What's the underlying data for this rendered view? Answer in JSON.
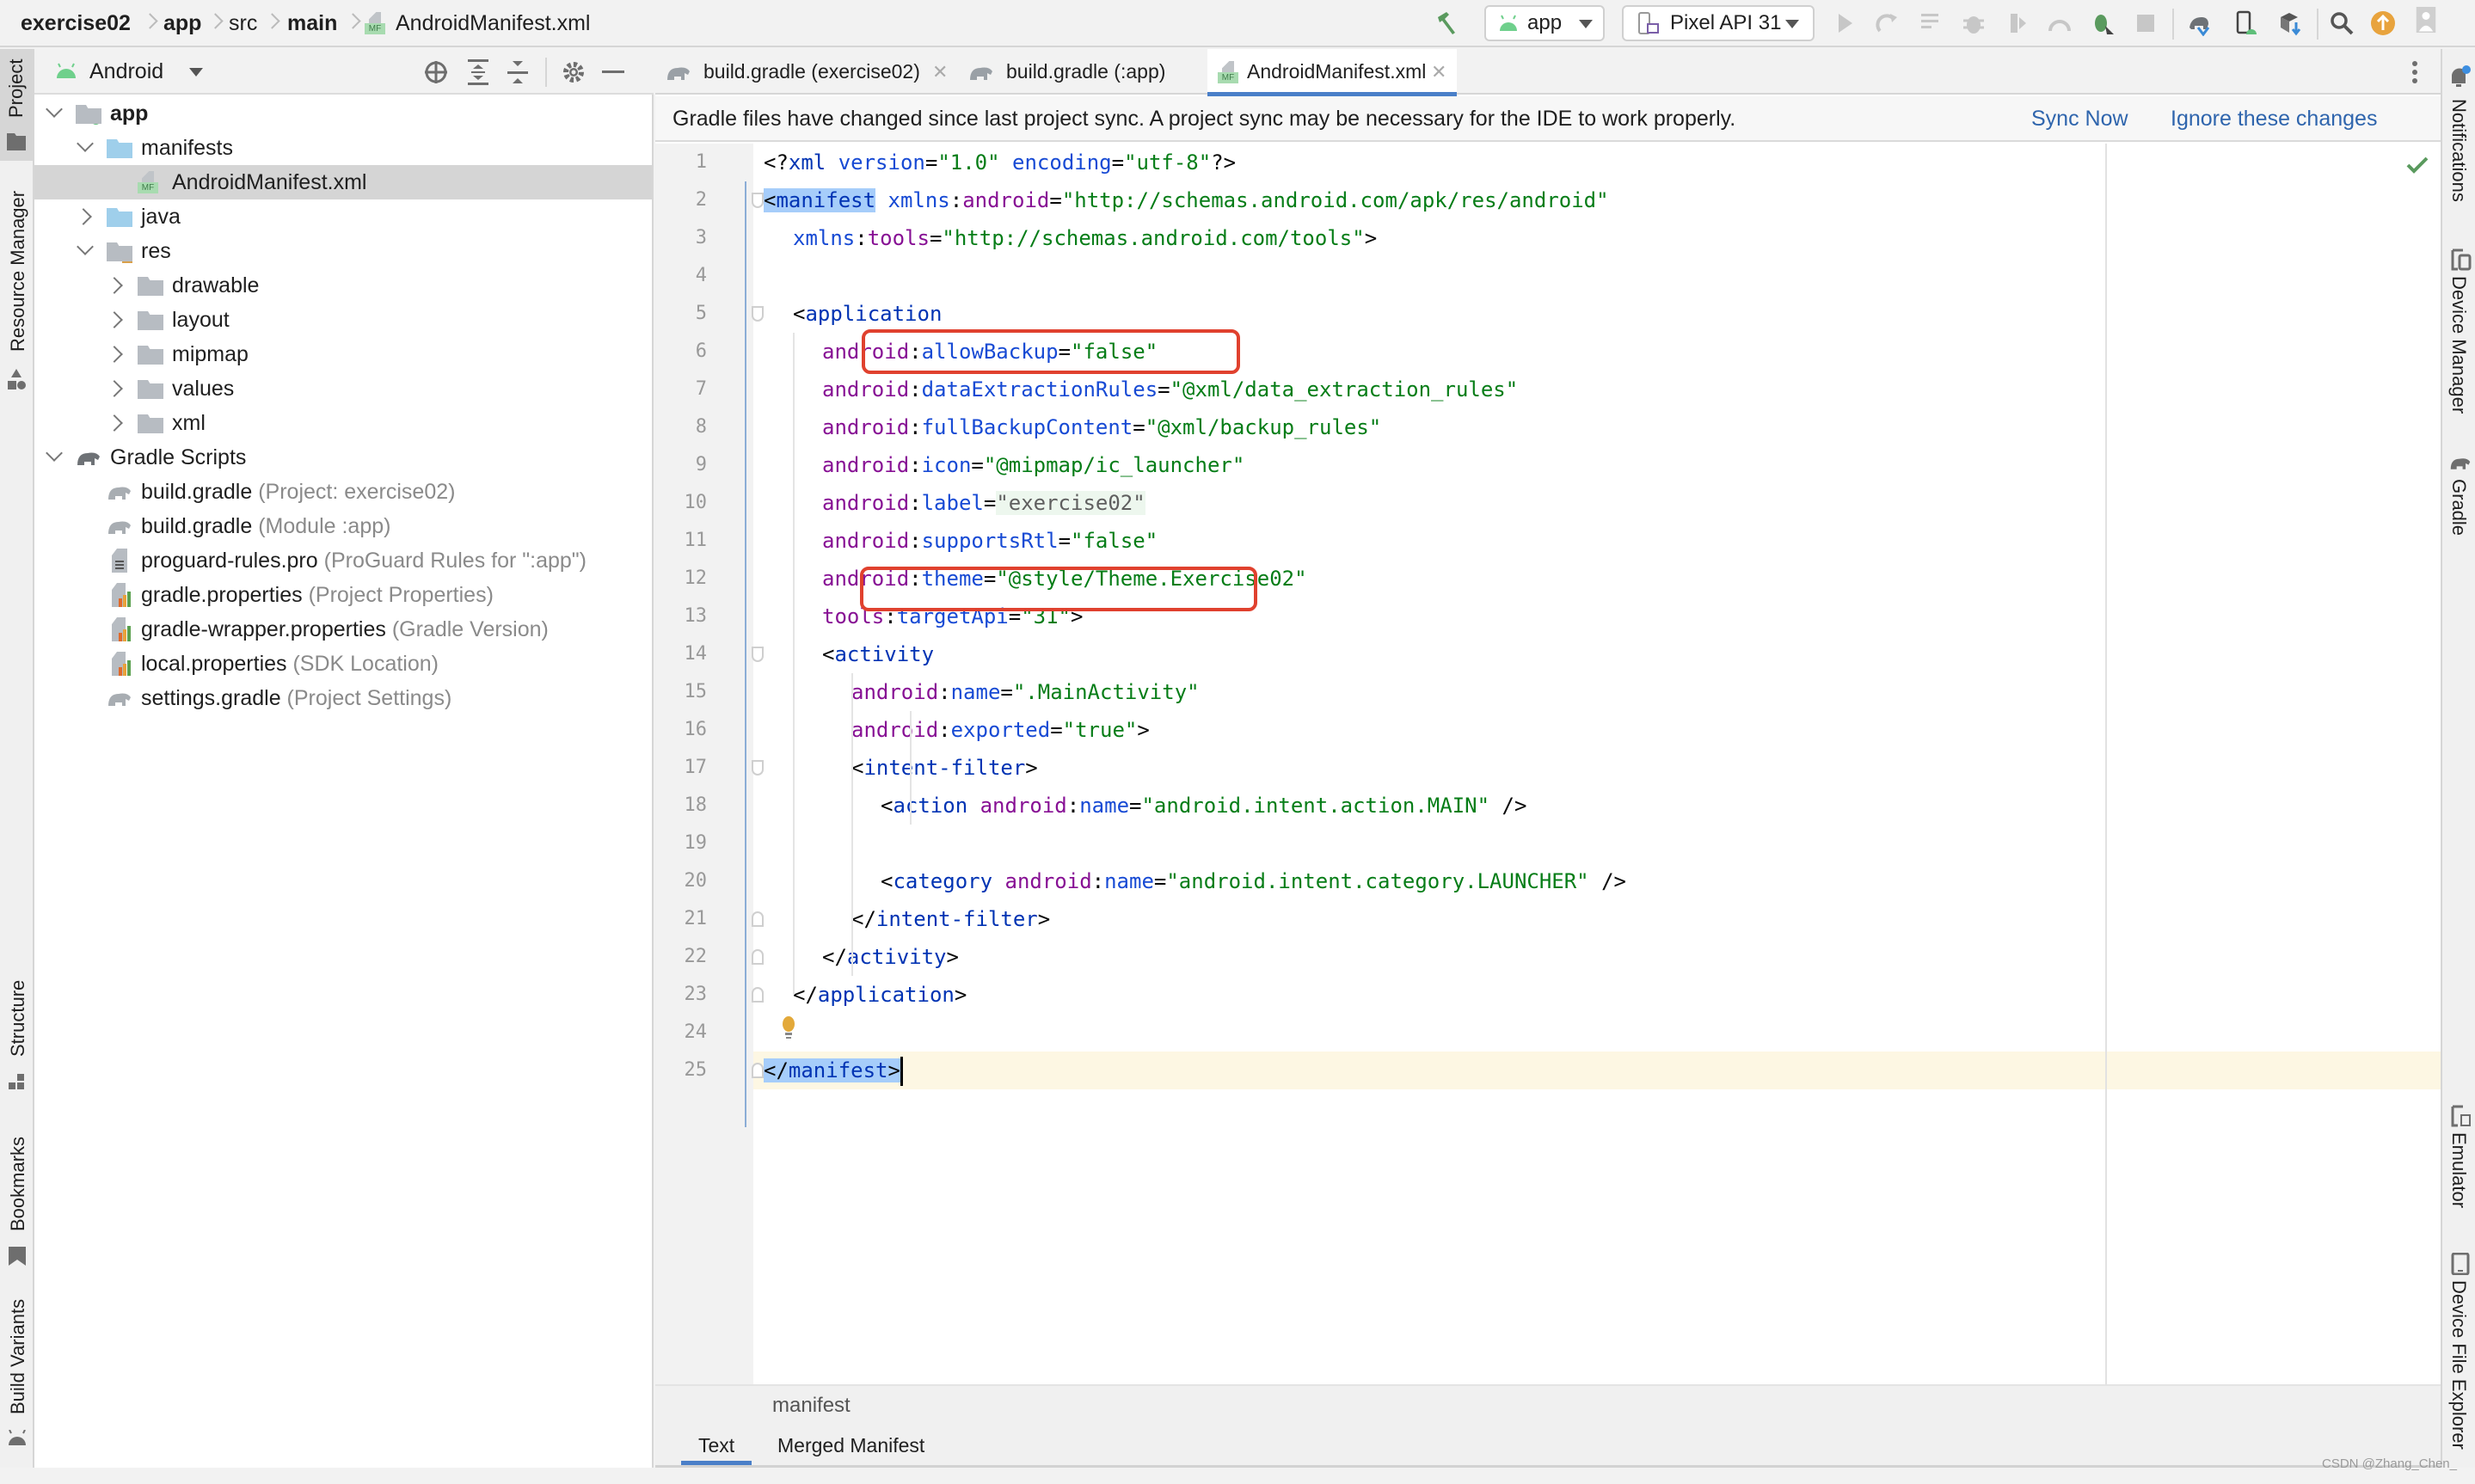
{
  "breadcrumb": [
    {
      "label": "exercise02",
      "bold": true
    },
    {
      "label": "app",
      "bold": true
    },
    {
      "label": "src",
      "bold": false
    },
    {
      "label": "main",
      "bold": true
    },
    {
      "label": "AndroidManifest.xml",
      "bold": false,
      "icon": "manifest-file-icon"
    }
  ],
  "toolbar": {
    "run_config": "app",
    "device": "Pixel API 31",
    "icons": [
      "build-hammer-icon",
      "run-icon",
      "apply-changes-icon",
      "apply-code-changes-icon",
      "debug-icon",
      "profile-icon",
      "attach-debugger-icon",
      "stop-icon",
      "gradle-sync-icon",
      "device-manager-icon",
      "sdk-manager-icon",
      "search-icon",
      "update-icon",
      "account-icon"
    ],
    "colors": {
      "accent_green": "#5a9a5e",
      "update_orange": "#e8a33d"
    }
  },
  "left_strip": {
    "top": [
      {
        "label": "Project",
        "active": true
      },
      {
        "label": "Resource Manager"
      }
    ],
    "bottom": [
      {
        "label": "Structure"
      },
      {
        "label": "Bookmarks"
      },
      {
        "label": "Build Variants"
      }
    ]
  },
  "right_strip": {
    "top": [
      {
        "label": "Notifications"
      },
      {
        "label": "Device Manager"
      },
      {
        "label": "Gradle"
      }
    ],
    "bottom": [
      {
        "label": "Emulator"
      },
      {
        "label": "Device File Explorer"
      }
    ]
  },
  "project_panel": {
    "view_selector": "Android",
    "tree": [
      {
        "depth": 0,
        "label": "app",
        "bold": true,
        "expanded": true,
        "icon": "module"
      },
      {
        "depth": 1,
        "label": "manifests",
        "expanded": true,
        "icon": "folder-blue"
      },
      {
        "depth": 2,
        "label": "AndroidManifest.xml",
        "icon": "manifest",
        "selected": true
      },
      {
        "depth": 1,
        "label": "java",
        "expanded": false,
        "icon": "folder-blue"
      },
      {
        "depth": 1,
        "label": "res",
        "expanded": true,
        "icon": "res-folder"
      },
      {
        "depth": 2,
        "label": "drawable",
        "expanded": false,
        "icon": "folder-gray"
      },
      {
        "depth": 2,
        "label": "layout",
        "expanded": false,
        "icon": "folder-gray"
      },
      {
        "depth": 2,
        "label": "mipmap",
        "expanded": false,
        "icon": "folder-gray"
      },
      {
        "depth": 2,
        "label": "values",
        "expanded": false,
        "icon": "folder-gray"
      },
      {
        "depth": 2,
        "label": "xml",
        "expanded": false,
        "icon": "folder-gray"
      },
      {
        "depth": 0,
        "label": "Gradle Scripts",
        "expanded": true,
        "icon": "gradle"
      },
      {
        "depth": 1,
        "label": "build.gradle",
        "hint": "(Project: exercise02)",
        "icon": "gradle-file"
      },
      {
        "depth": 1,
        "label": "build.gradle",
        "hint": "(Module :app)",
        "icon": "gradle-file"
      },
      {
        "depth": 1,
        "label": "proguard-rules.pro",
        "hint": "(ProGuard Rules for \":app\")",
        "icon": "text-file"
      },
      {
        "depth": 1,
        "label": "gradle.properties",
        "hint": "(Project Properties)",
        "icon": "properties"
      },
      {
        "depth": 1,
        "label": "gradle-wrapper.properties",
        "hint": "(Gradle Version)",
        "icon": "properties"
      },
      {
        "depth": 1,
        "label": "local.properties",
        "hint": "(SDK Location)",
        "icon": "properties"
      },
      {
        "depth": 1,
        "label": "settings.gradle",
        "hint": "(Project Settings)",
        "icon": "gradle-file"
      }
    ]
  },
  "editor": {
    "tabs": [
      {
        "label": "build.gradle (exercise02)",
        "icon": "gradle-file",
        "active": false
      },
      {
        "label": "build.gradle (:app)",
        "icon": "gradle-file",
        "active": false
      },
      {
        "label": "AndroidManifest.xml",
        "icon": "manifest",
        "active": true
      }
    ],
    "notification": {
      "message": "Gradle files have changed since last project sync. A project sync may be necessary for the IDE to work properly.",
      "actions": [
        "Sync Now",
        "Ignore these changes"
      ]
    },
    "status": "no-problems-check",
    "lines": [
      {
        "n": "1",
        "indent": 0,
        "tokens": [
          [
            "p",
            "<?"
          ],
          [
            "t",
            "xml "
          ],
          [
            "at",
            "version"
          ],
          [
            "p",
            "="
          ],
          [
            "v",
            "\"1.0\""
          ],
          [
            "p",
            " "
          ],
          [
            "at",
            "encoding"
          ],
          [
            "p",
            "="
          ],
          [
            "v",
            "\"utf-8\""
          ],
          [
            "p",
            "?>"
          ]
        ]
      },
      {
        "n": "2",
        "indent": 0,
        "tokens": [
          [
            "sel",
            "<manifest"
          ],
          [
            "p",
            " "
          ],
          [
            "at",
            "xmlns"
          ],
          [
            "p",
            ":"
          ],
          [
            "ns",
            "android"
          ],
          [
            "p",
            "="
          ],
          [
            "v",
            "\"http://schemas.android.com/apk/res/android\""
          ]
        ]
      },
      {
        "n": "3",
        "indent": 1,
        "tokens": [
          [
            "at",
            "xmlns"
          ],
          [
            "p",
            ":"
          ],
          [
            "ns",
            "tools"
          ],
          [
            "p",
            "="
          ],
          [
            "v",
            "\"http://schemas.android.com/tools\""
          ],
          [
            "p",
            ">"
          ]
        ]
      },
      {
        "n": "4",
        "indent": 0,
        "tokens": []
      },
      {
        "n": "5",
        "indent": 1,
        "tokens": [
          [
            "p",
            "<"
          ],
          [
            "t",
            "application"
          ]
        ]
      },
      {
        "n": "6",
        "indent": 2,
        "tokens": [
          [
            "ns",
            "android"
          ],
          [
            "p",
            ":"
          ],
          [
            "at",
            "allowBackup"
          ],
          [
            "p",
            "="
          ],
          [
            "v",
            "\"false\""
          ]
        ],
        "highlighted": true
      },
      {
        "n": "7",
        "indent": 2,
        "tokens": [
          [
            "ns",
            "android"
          ],
          [
            "p",
            ":"
          ],
          [
            "at",
            "dataExtractionRules"
          ],
          [
            "p",
            "="
          ],
          [
            "v",
            "\"@xml/data_extraction_rules\""
          ]
        ]
      },
      {
        "n": "8",
        "indent": 2,
        "tokens": [
          [
            "ns",
            "android"
          ],
          [
            "p",
            ":"
          ],
          [
            "at",
            "fullBackupContent"
          ],
          [
            "p",
            "="
          ],
          [
            "v",
            "\"@xml/backup_rules\""
          ]
        ]
      },
      {
        "n": "9",
        "indent": 2,
        "tokens": [
          [
            "ns",
            "android"
          ],
          [
            "p",
            ":"
          ],
          [
            "at",
            "icon"
          ],
          [
            "p",
            "="
          ],
          [
            "v",
            "\"@mipmap/ic_launcher\""
          ]
        ]
      },
      {
        "n": "10",
        "indent": 2,
        "tokens": [
          [
            "ns",
            "android"
          ],
          [
            "p",
            ":"
          ],
          [
            "at",
            "label"
          ],
          [
            "p",
            "="
          ],
          [
            "fv",
            "\"exercise02\""
          ]
        ]
      },
      {
        "n": "11",
        "indent": 2,
        "tokens": [
          [
            "ns",
            "android"
          ],
          [
            "p",
            ":"
          ],
          [
            "at",
            "supportsRtl"
          ],
          [
            "p",
            "="
          ],
          [
            "v",
            "\"false\""
          ]
        ],
        "highlighted": true
      },
      {
        "n": "12",
        "indent": 2,
        "tokens": [
          [
            "ns",
            "android"
          ],
          [
            "p",
            ":"
          ],
          [
            "at",
            "theme"
          ],
          [
            "p",
            "="
          ],
          [
            "v",
            "\"@style/Theme.Exercise02\""
          ]
        ]
      },
      {
        "n": "13",
        "indent": 2,
        "tokens": [
          [
            "ns",
            "tools"
          ],
          [
            "p",
            ":"
          ],
          [
            "at",
            "targetApi"
          ],
          [
            "p",
            "="
          ],
          [
            "v",
            "\"31\""
          ],
          [
            "p",
            ">"
          ]
        ]
      },
      {
        "n": "14",
        "indent": 2,
        "tokens": [
          [
            "p",
            "<"
          ],
          [
            "t",
            "activity"
          ]
        ]
      },
      {
        "n": "15",
        "indent": 3,
        "tokens": [
          [
            "ns",
            "android"
          ],
          [
            "p",
            ":"
          ],
          [
            "at",
            "name"
          ],
          [
            "p",
            "="
          ],
          [
            "v",
            "\".MainActivity\""
          ]
        ]
      },
      {
        "n": "16",
        "indent": 3,
        "tokens": [
          [
            "ns",
            "android"
          ],
          [
            "p",
            ":"
          ],
          [
            "at",
            "exported"
          ],
          [
            "p",
            "="
          ],
          [
            "v",
            "\"true\""
          ],
          [
            "p",
            ">"
          ]
        ]
      },
      {
        "n": "17",
        "indent": 3,
        "tokens": [
          [
            "p",
            "<"
          ],
          [
            "t",
            "intent-filter"
          ],
          [
            "p",
            ">"
          ]
        ]
      },
      {
        "n": "18",
        "indent": 4,
        "tokens": [
          [
            "p",
            "<"
          ],
          [
            "t",
            "action "
          ],
          [
            "ns",
            "android"
          ],
          [
            "p",
            ":"
          ],
          [
            "at",
            "name"
          ],
          [
            "p",
            "="
          ],
          [
            "v",
            "\"android.intent.action.MAIN\""
          ],
          [
            "p",
            " />"
          ]
        ]
      },
      {
        "n": "19",
        "indent": 0,
        "tokens": []
      },
      {
        "n": "20",
        "indent": 4,
        "tokens": [
          [
            "p",
            "<"
          ],
          [
            "t",
            "category "
          ],
          [
            "ns",
            "android"
          ],
          [
            "p",
            ":"
          ],
          [
            "at",
            "name"
          ],
          [
            "p",
            "="
          ],
          [
            "v",
            "\"android.intent.category.LAUNCHER\""
          ],
          [
            "p",
            " />"
          ]
        ]
      },
      {
        "n": "21",
        "indent": 3,
        "tokens": [
          [
            "p",
            "</"
          ],
          [
            "t",
            "intent-filter"
          ],
          [
            "p",
            ">"
          ]
        ]
      },
      {
        "n": "22",
        "indent": 2,
        "tokens": [
          [
            "p",
            "</"
          ],
          [
            "t",
            "activity"
          ],
          [
            "p",
            ">"
          ]
        ]
      },
      {
        "n": "23",
        "indent": 1,
        "tokens": [
          [
            "p",
            "</"
          ],
          [
            "t",
            "application"
          ],
          [
            "p",
            ">"
          ]
        ]
      },
      {
        "n": "24",
        "indent": 0,
        "tokens": [],
        "intention_bulb": true
      },
      {
        "n": "25",
        "indent": 0,
        "tokens": [
          [
            "sel",
            "</manifest>"
          ]
        ],
        "current": true
      }
    ],
    "highlight_color": "#e0412e",
    "breadcrumb": "manifest",
    "bottom_tabs": [
      {
        "label": "Text",
        "active": true
      },
      {
        "label": "Merged Manifest",
        "active": false
      }
    ]
  },
  "watermark": "CSDN @Zhang_Chen_"
}
